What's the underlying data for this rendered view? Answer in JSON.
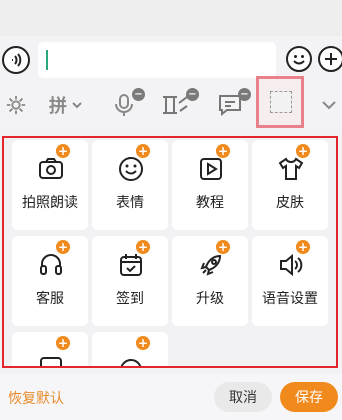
{
  "colors": {
    "accent": "#f08a1c",
    "highlight_border": "#e2262b",
    "toolbar_highlight": "#e9808a"
  },
  "toolbar": {
    "pinyin_label": "拼",
    "items": [
      "gear-icon",
      "pinyin-icon",
      "mic-icon",
      "handwrite-icon",
      "keyboard-message-icon",
      "empty-slot",
      "chevron-down-icon"
    ]
  },
  "grid": {
    "items": [
      {
        "label": "拍照朗读",
        "icon": "camera-icon"
      },
      {
        "label": "表情",
        "icon": "smile-icon"
      },
      {
        "label": "教程",
        "icon": "play-icon"
      },
      {
        "label": "皮肤",
        "icon": "tshirt-icon"
      },
      {
        "label": "客服",
        "icon": "headset-icon"
      },
      {
        "label": "签到",
        "icon": "calendar-check-icon"
      },
      {
        "label": "升级",
        "icon": "rocket-icon"
      },
      {
        "label": "语音设置",
        "icon": "speaker-icon"
      }
    ]
  },
  "footer": {
    "restore_label": "恢复默认",
    "cancel_label": "取消",
    "save_label": "保存"
  }
}
